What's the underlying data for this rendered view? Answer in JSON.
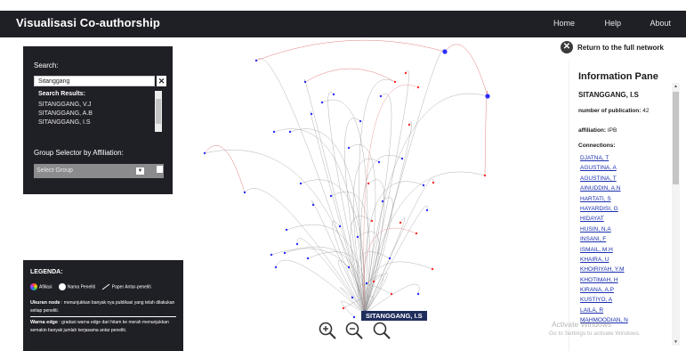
{
  "header": {
    "title": "Visualisasi Co-authorship",
    "nav": [
      "Home",
      "Help",
      "About"
    ]
  },
  "search": {
    "label": "Search:",
    "value": "Sitanggang",
    "clear_icon": "close-icon",
    "results_label": "Search Results:",
    "results": [
      "SITANGGANG, V.J",
      "SITANGGANG, A.B",
      "SITANGGANG, I.S"
    ],
    "group_label": "Group Selector by Affiliation:",
    "group_value": "Select Group"
  },
  "legend": {
    "title": "LEGENDA:",
    "items": [
      "Afiliasi",
      "Nama Peneliti",
      "Paper Antar-peneliti"
    ],
    "node_title": "Ukuran node",
    "node_text": ": menunjukkan banyak nya publikasi yang telah dilakukan setiap peneliti.",
    "edge_title": "Warna edge",
    "edge_text": ": gradasi warna edge dari hitam ke merah menunjukkan semakin banyak jumlah kerjasama antar peneliti."
  },
  "graph": {
    "focus_label": "SITANGGANG, I.S",
    "colors": {
      "author": "#2d2dff",
      "affiliation": "#ff2a2a",
      "edge": "#9a9a9a",
      "edge_strong": "#e47f7f"
    }
  },
  "info": {
    "return_label": "Return to the full network",
    "title": "Information Pane",
    "name": "SITANGGANG, I.S",
    "publications_label": "number of publication:",
    "publications": "42",
    "affiliation_label": "affiliation:",
    "affiliation": "IPB",
    "connections_label": "Connections:",
    "connections": [
      "DJATNA, T",
      "AGUSTINA, A",
      "AGUSTINA, T",
      "AINUDDIN, A.N",
      "HARTATI, S",
      "HAYARDISI, G",
      "HIDAYAT",
      "HUSIN, N.A",
      "INSANI, F",
      "ISMAIL, M.H",
      "KHAIRA, U",
      "KHOIRIYAH, Y.M",
      "KHOTIMAH, H",
      "KIRANA, A.P",
      "KUSTIYO, A",
      "LAILA, R",
      "MAHMOODIAN, N"
    ]
  },
  "zoom": [
    "zoom-in-icon",
    "zoom-out-icon",
    "zoom-reset-icon"
  ],
  "watermark": {
    "line1": "Activate Windows",
    "line2": "Go to Settings to activate Windows."
  }
}
